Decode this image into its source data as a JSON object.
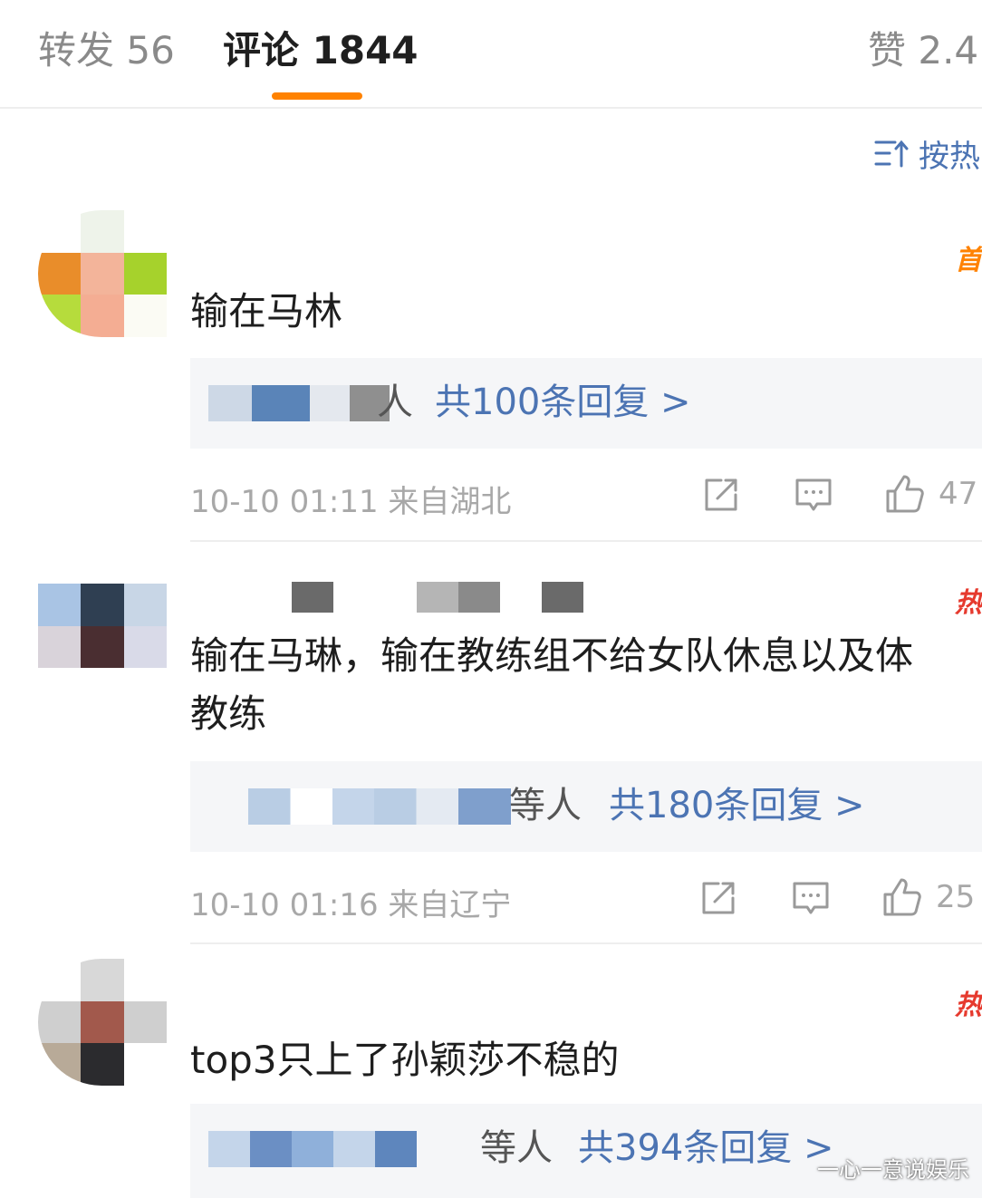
{
  "tabs": {
    "repost": "转发 56",
    "comment": "评论 1844",
    "like": "赞 2.4"
  },
  "sort": {
    "label": "按热"
  },
  "comments": [
    {
      "tag": "首",
      "text": "输在马林",
      "reply_suffix": "人",
      "reply_link": "共100条回复 >",
      "meta": "10-10 01:11 来自湖北",
      "likes": "47"
    },
    {
      "tag": "热",
      "text": "输在马琳，输在教练组不给女队休息以及体\n教练",
      "reply_suffix": "等人",
      "reply_link": "共180条回复 >",
      "meta": "10-10 01:16 来自辽宁",
      "likes": "25"
    },
    {
      "tag": "热",
      "text": "top3只上了孙颖莎不稳的",
      "reply_suffix": "等人",
      "reply_link": "共394条回复 >"
    }
  ],
  "colors": {
    "accent": "#ff8200",
    "link": "#4c74b3",
    "hot": "#e63a2e"
  },
  "icons": [
    "sort-icon",
    "share-icon",
    "comment-icon",
    "like-icon"
  ],
  "watermark": "一心一意说娱乐"
}
